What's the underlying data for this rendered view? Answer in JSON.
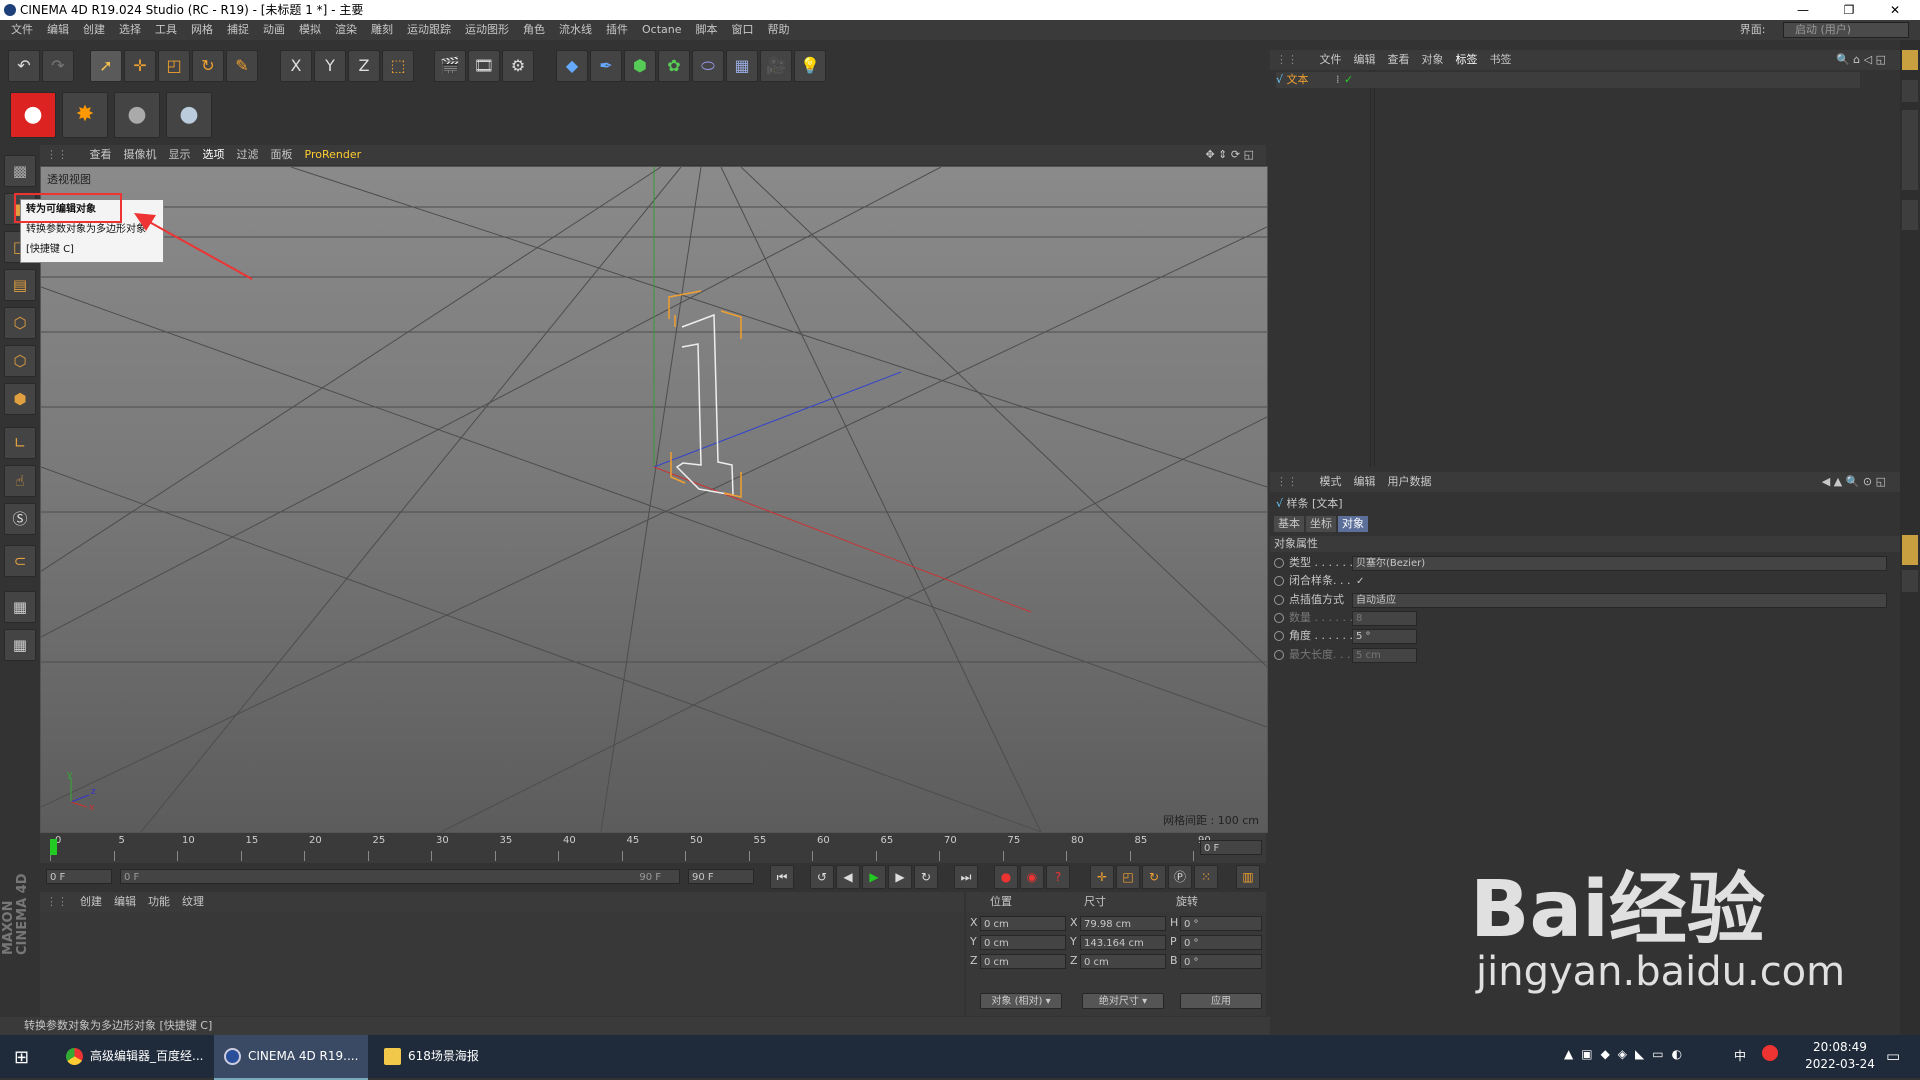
{
  "window": {
    "title": "CINEMA 4D R19.024 Studio (RC - R19) - [未标题 1 *] - 主要",
    "minimize": "—",
    "maximize": "❐",
    "close": "✕"
  },
  "menubar": {
    "items": [
      "文件",
      "编辑",
      "创建",
      "选择",
      "工具",
      "网格",
      "捕捉",
      "动画",
      "模拟",
      "渲染",
      "雕刻",
      "运动跟踪",
      "运动图形",
      "角色",
      "流水线",
      "插件",
      "Octane",
      "脚本",
      "窗口",
      "帮助"
    ],
    "layout_label": "界面:",
    "layout_value": "启动 (用户)"
  },
  "toolbar": {
    "x": "X",
    "y": "Y",
    "z": "Z"
  },
  "viewport": {
    "menu": [
      "查看",
      "摄像机",
      "显示",
      "选项",
      "过滤",
      "面板",
      "ProRender"
    ],
    "label": "透视视图",
    "grid_spacing": "网格间距 : 100 cm",
    "axis_x": "x",
    "axis_y": "y",
    "axis_z": "z"
  },
  "tooltip": {
    "title": "转为可编辑对象",
    "desc": "转换参数对象为多边形对象",
    "shortcut": "[快捷键 C]"
  },
  "timeline": {
    "ticks": [
      "0",
      "5",
      "10",
      "15",
      "20",
      "25",
      "30",
      "35",
      "40",
      "45",
      "50",
      "55",
      "60",
      "65",
      "70",
      "75",
      "80",
      "85",
      "90"
    ],
    "current_frame": "0 F"
  },
  "transport": {
    "start": "0 F",
    "range_start": "0 F",
    "range_end": "90 F",
    "end": "90 F"
  },
  "materials": {
    "menu": [
      "创建",
      "编辑",
      "功能",
      "纹理"
    ]
  },
  "coords": {
    "headers": [
      "位置",
      "尺寸",
      "旋转"
    ],
    "rows": [
      {
        "axis": "X",
        "pos": "0 cm",
        "size_axis": "X",
        "size": "79.98 cm",
        "rot_axis": "H",
        "rot": "0 °"
      },
      {
        "axis": "Y",
        "pos": "0 cm",
        "size_axis": "Y",
        "size": "143.164 cm",
        "rot_axis": "P",
        "rot": "0 °"
      },
      {
        "axis": "Z",
        "pos": "0 cm",
        "size_axis": "Z",
        "size": "0 cm",
        "rot_axis": "B",
        "rot": "0 °"
      }
    ],
    "mode": "对象 (相对)",
    "size_mode": "绝对尺寸",
    "apply": "应用"
  },
  "statusbar": {
    "text": "转换参数对象为多边形对象 [快捷键 C]"
  },
  "objects": {
    "menu": [
      "文件",
      "编辑",
      "查看",
      "对象",
      "标签",
      "书签"
    ],
    "item": "文本"
  },
  "attributes": {
    "menu": [
      "模式",
      "编辑",
      "用户数据"
    ],
    "header": "样条 [文本]",
    "tabs": [
      "基本",
      "坐标",
      "对象"
    ],
    "section": "对象属性",
    "props": [
      {
        "label": "类型 . . . . . .",
        "value": "贝塞尔(Bezier)"
      },
      {
        "label": "闭合样条. . .",
        "value": "✓"
      },
      {
        "label": "点插值方式",
        "value": "自动适应"
      },
      {
        "label": "数量 . . . . . .",
        "value": "8"
      },
      {
        "label": "角度 . . . . . .",
        "value": "5 °"
      },
      {
        "label": "最大长度. . .",
        "value": "5 cm"
      }
    ]
  },
  "brand": {
    "maxon": "MAXON",
    "c4d": "CINEMA 4D"
  },
  "taskbar": {
    "items": [
      "高级编辑器_百度经...",
      "CINEMA 4D R19....",
      "618场景海报"
    ],
    "time": "20:08:49",
    "date": "2022-03-24",
    "ime": "中"
  },
  "watermark": {
    "line1": "Bai经验",
    "line2": "jingyan.baidu.com"
  }
}
